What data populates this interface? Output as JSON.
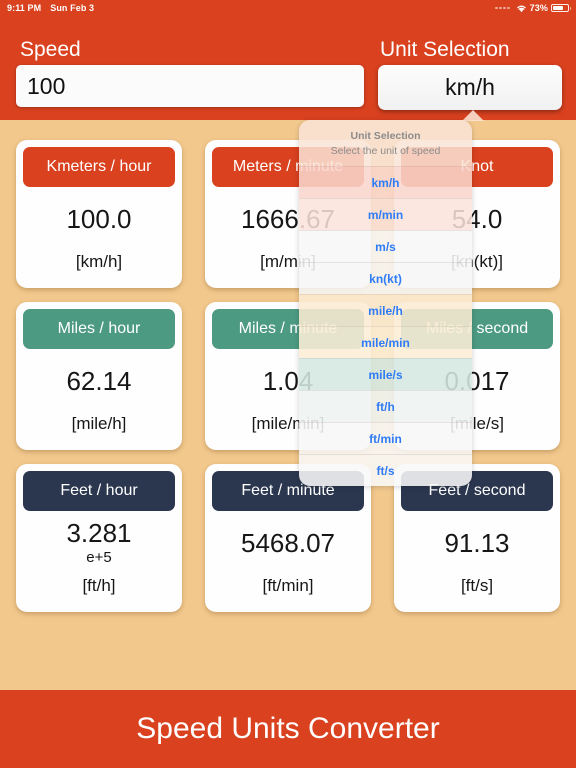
{
  "statusbar": {
    "time": "9:11 PM",
    "date": "Sun Feb 3",
    "battery_percent": "73%",
    "wifi_icon": "wifi-icon",
    "battery_icon": "battery-icon"
  },
  "header": {
    "speed_label": "Speed",
    "unit_label": "Unit Selection",
    "speed_value": "100",
    "speed_placeholder": "Speed",
    "selected_unit": "km/h"
  },
  "colors": {
    "accent_red": "#D9411F",
    "accent_green": "#4D9A82",
    "accent_navy": "#2B374F",
    "background_tan": "#F2C88D",
    "link_blue": "#2F7CF6"
  },
  "cards": [
    {
      "title": "Kmeters / hour",
      "value": "100.0",
      "exponent": "",
      "unit": "[km/h]",
      "color": "red"
    },
    {
      "title": "Meters / minute",
      "value": "1666.67",
      "exponent": "",
      "unit": "[m/min]",
      "color": "red"
    },
    {
      "title": "Knot",
      "value": "54.0",
      "exponent": "",
      "unit": "[kn(kt)]",
      "color": "red"
    },
    {
      "title": "Miles / hour",
      "value": "62.14",
      "exponent": "",
      "unit": "[mile/h]",
      "color": "green"
    },
    {
      "title": "Miles / minute",
      "value": "1.04",
      "exponent": "",
      "unit": "[mile/min]",
      "color": "green"
    },
    {
      "title": "Miles / second",
      "value": "0.017",
      "exponent": "",
      "unit": "[mile/s]",
      "color": "green"
    },
    {
      "title": "Feet / hour",
      "value": "3.281",
      "exponent": "e+5",
      "unit": "[ft/h]",
      "color": "navy"
    },
    {
      "title": "Feet / minute",
      "value": "5468.07",
      "exponent": "",
      "unit": "[ft/min]",
      "color": "navy"
    },
    {
      "title": "Feet / second",
      "value": "91.13",
      "exponent": "",
      "unit": "[ft/s]",
      "color": "navy"
    }
  ],
  "popover": {
    "title": "Unit Selection",
    "subtitle": "Select the unit of speed",
    "options": [
      "km/h",
      "m/min",
      "m/s",
      "kn(kt)",
      "mile/h",
      "mile/min",
      "mile/s",
      "ft/h",
      "ft/min",
      "ft/s"
    ]
  },
  "footer": {
    "title": "Speed Units Converter"
  }
}
